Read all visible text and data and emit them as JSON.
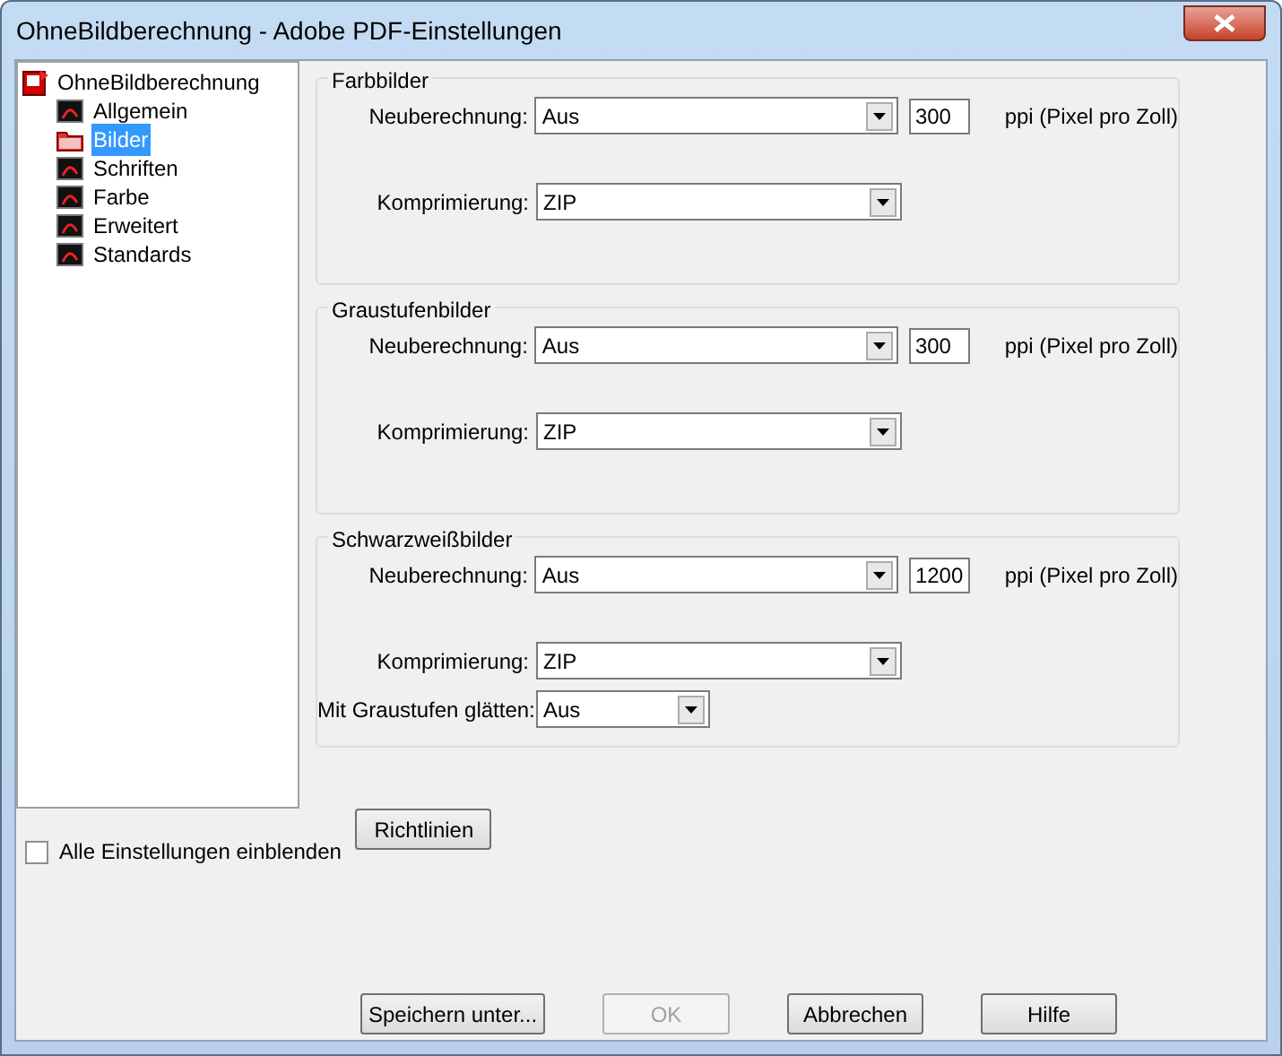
{
  "window": {
    "title": "OhneBildberechnung - Adobe PDF-Einstellungen"
  },
  "tree": {
    "label": "OhneBildberechnung",
    "children": [
      {
        "label": "Allgemein",
        "selected": false
      },
      {
        "label": "Bilder",
        "selected": true
      },
      {
        "label": "Schriften",
        "selected": false
      },
      {
        "label": "Farbe",
        "selected": false
      },
      {
        "label": "Erweitert",
        "selected": false
      },
      {
        "label": "Standards",
        "selected": false
      }
    ]
  },
  "groups": [
    {
      "title": "Farbbilder",
      "rows": [
        {
          "kind": "resample",
          "label": "Neuberechnung:",
          "value": "Aus",
          "ppi": "300",
          "unit": "ppi (Pixel pro Zoll)"
        },
        {
          "kind": "select",
          "label": "Komprimierung:",
          "value": "ZIP"
        }
      ]
    },
    {
      "title": "Graustufenbilder",
      "rows": [
        {
          "kind": "resample",
          "label": "Neuberechnung:",
          "value": "Aus",
          "ppi": "300",
          "unit": "ppi (Pixel pro Zoll)"
        },
        {
          "kind": "select",
          "label": "Komprimierung:",
          "value": "ZIP"
        }
      ]
    },
    {
      "title": "Schwarzweißbilder",
      "rows": [
        {
          "kind": "resample",
          "label": "Neuberechnung:",
          "value": "Aus",
          "ppi": "1200",
          "unit": "ppi (Pixel pro Zoll)"
        },
        {
          "kind": "select",
          "label": "Komprimierung:",
          "value": "ZIP"
        },
        {
          "kind": "small_select",
          "label": "Mit Graustufen glätten:",
          "value": "Aus"
        }
      ]
    }
  ],
  "show_all": {
    "label": "Alle Einstellungen einblenden",
    "checked": false
  },
  "guidelines_button": "Richtlinien",
  "buttons": [
    {
      "label": "Speichern unter...",
      "disabled": false
    },
    {
      "label": "OK",
      "disabled": true
    },
    {
      "label": "Abbrechen",
      "disabled": false
    },
    {
      "label": "Hilfe",
      "disabled": false
    }
  ]
}
